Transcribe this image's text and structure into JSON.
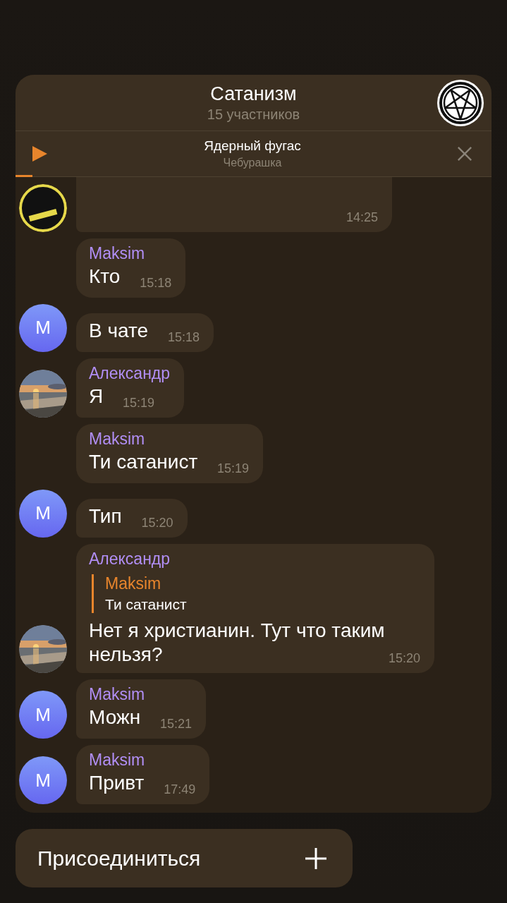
{
  "chat": {
    "title": "Сатанизм",
    "subtitle": "15 участников"
  },
  "player": {
    "track": "Ядерный фугас",
    "artist": "Чебурашка",
    "playing": false,
    "level": 0.035
  },
  "messages": [
    {
      "time": "14:25",
      "avatar": {
        "kind": "sticker"
      },
      "tail": true
    },
    {
      "sender": "Maksim",
      "text": "Кто",
      "time": "15:18",
      "tail": false
    },
    {
      "text": "В чате",
      "time": "15:18",
      "avatar": {
        "kind": "initial",
        "initial": "M"
      },
      "tail": true
    },
    {
      "sender": "Александр",
      "text": "Я",
      "time": "15:19",
      "tail": true
    },
    {
      "sender": "Maksim",
      "text": "Ти сатанист",
      "time": "15:19",
      "tail": false
    },
    {
      "text": "Тип",
      "time": "15:20",
      "avatar": {
        "kind": "initial",
        "initial": "M"
      },
      "tail": true
    },
    {
      "sender": "Александр",
      "reply": {
        "sender": "Maksim",
        "text": "Ти сатанист"
      },
      "text": "Нет я христианин. Тут что таким нельзя?",
      "time": "15:20",
      "tail": true
    },
    {
      "sender": "Maksim",
      "text": "Можн",
      "time": "15:21",
      "avatar": {
        "kind": "initial",
        "initial": "M"
      },
      "tail": true
    },
    {
      "sender": "Maksim",
      "text": "Привт",
      "time": "17:49",
      "avatar": {
        "kind": "initial",
        "initial": "M"
      },
      "tail": true
    }
  ],
  "join_button": {
    "label": "Присоединиться"
  }
}
